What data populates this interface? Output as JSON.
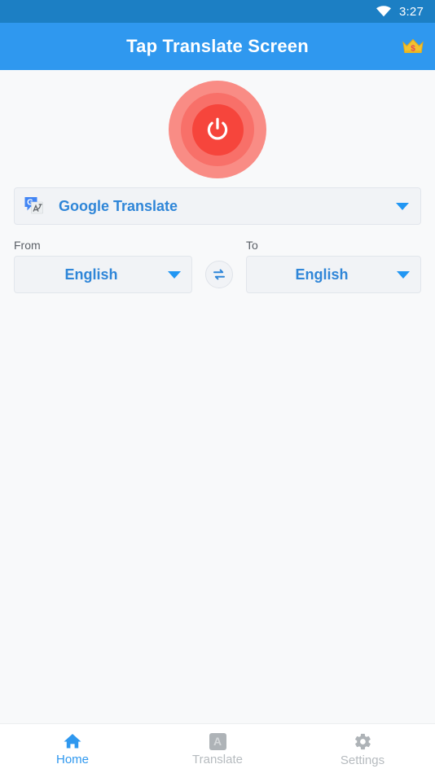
{
  "status_bar": {
    "time": "3:27",
    "wifi_icon": "wifi-icon",
    "background_color": "#1c7fc4"
  },
  "app_bar": {
    "title": "Tap Translate Screen",
    "background_color": "#2f98ef",
    "premium_icon": "crown-icon"
  },
  "main": {
    "power_button": {
      "icon": "power-icon",
      "outer_color": "#f98c85",
      "mid_color": "#f87069",
      "inner_color": "#f6453c",
      "state": "off"
    },
    "engine_selector": {
      "icon": "google-translate-icon",
      "label": "Google Translate",
      "caret_icon": "chevron-down-icon",
      "accent_color": "#2f86d8"
    },
    "language_row": {
      "from": {
        "label": "From",
        "value": "English",
        "caret_icon": "chevron-down-icon"
      },
      "swap": {
        "icon": "swap-arrows-icon"
      },
      "to": {
        "label": "To",
        "value": "English",
        "caret_icon": "chevron-down-icon"
      }
    }
  },
  "bottom_nav": {
    "items": [
      {
        "label": "Home",
        "icon": "home-icon",
        "active": true,
        "color": "#2f98ef"
      },
      {
        "label": "Translate",
        "icon": "translate-letter-a-icon",
        "active": false,
        "color": "#b6bbbf"
      },
      {
        "label": "Settings",
        "icon": "gear-icon",
        "active": false,
        "color": "#b6bbbf"
      }
    ]
  }
}
